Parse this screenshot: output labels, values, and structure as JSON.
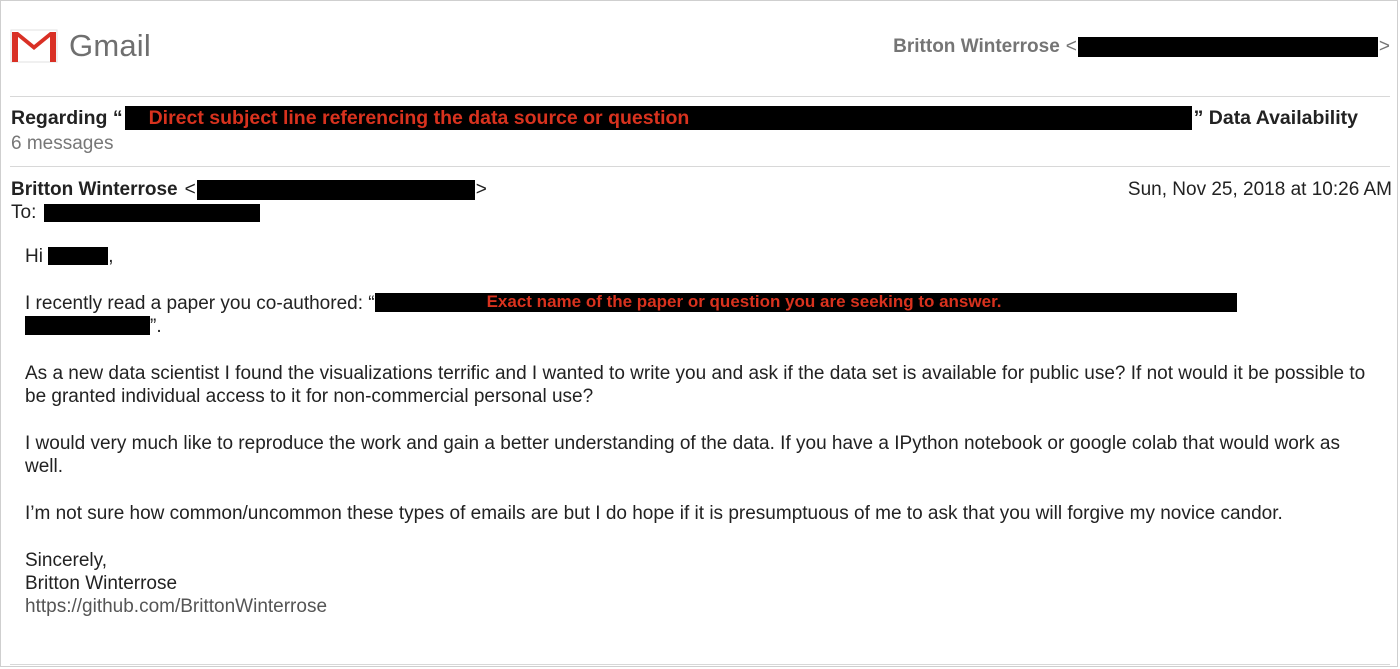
{
  "app": {
    "name": "Gmail",
    "colors": {
      "logo_red": "#d93025",
      "logo_text": "#6f6f6f",
      "annotation": "#d8321e"
    },
    "logo_icon": "gmail-envelope-icon"
  },
  "header": {
    "account_name": "Britton Winterrose",
    "account_open": "<",
    "account_close": ">"
  },
  "thread": {
    "subject_prefix": "Regarding “",
    "subject_annotation": "Direct subject line referencing the data source or question",
    "subject_suffix": "” Data Availability",
    "message_count": "6 messages"
  },
  "message": {
    "sender_name": "Britton Winterrose",
    "sender_open": "<",
    "sender_close": ">",
    "date": "Sun, Nov 25, 2018 at 10:26 AM",
    "to_label": "To:",
    "greeting": "Hi",
    "greeting_end": ",",
    "para1_start": "I recently read a paper you co-authored: “",
    "para1_annotation": "Exact name of the paper or question you are seeking to answer.",
    "para1_end": "”.",
    "para2": "As a new data scientist I found the visualizations terrific and I wanted to write you and ask if the data set is available for public use? If not would it be possible to be granted individual access to it for non-commercial personal use?",
    "para3": "I would very much like to reproduce the work and gain a better understanding of the data. If you have a IPython notebook or google colab that would work as well.",
    "para4": "I’m not sure how common/uncommon these types of emails are but I do hope if it is presumptuous of me to ask that you will forgive my novice candor.",
    "closing": "Sincerely,",
    "signature_name": "Britton Winterrose",
    "signature_link": "https://github.com/BrittonWinterrose"
  }
}
